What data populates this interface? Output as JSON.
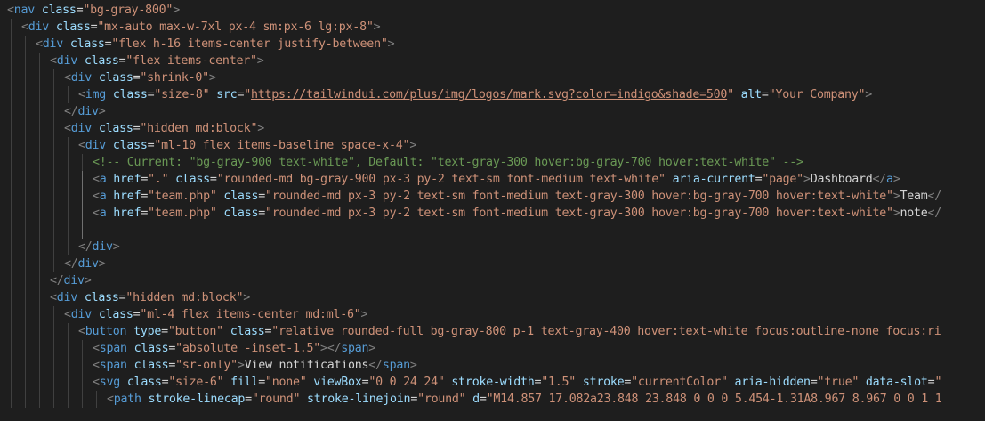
{
  "editor": {
    "colors": {
      "background": "#1e1e1e",
      "tag": "#569cd6",
      "bracket": "#808080",
      "attribute": "#9cdcfe",
      "string": "#ce9178",
      "comment": "#6a9955",
      "text": "#d4d4d4"
    },
    "lines": [
      {
        "indent": 0,
        "tokens": [
          [
            "p",
            "<"
          ],
          [
            "tag",
            "nav"
          ],
          [
            "text",
            " "
          ],
          [
            "attr",
            "class"
          ],
          [
            "eq",
            "="
          ],
          [
            "str",
            "\"bg-gray-800\""
          ],
          [
            "p",
            ">"
          ]
        ]
      },
      {
        "indent": 1,
        "tokens": [
          [
            "p",
            "<"
          ],
          [
            "tag",
            "div"
          ],
          [
            "text",
            " "
          ],
          [
            "attr",
            "class"
          ],
          [
            "eq",
            "="
          ],
          [
            "str",
            "\"mx-auto max-w-7xl px-4 sm:px-6 lg:px-8\""
          ],
          [
            "p",
            ">"
          ]
        ]
      },
      {
        "indent": 2,
        "tokens": [
          [
            "p",
            "<"
          ],
          [
            "tag",
            "div"
          ],
          [
            "text",
            " "
          ],
          [
            "attr",
            "class"
          ],
          [
            "eq",
            "="
          ],
          [
            "str",
            "\"flex h-16 items-center justify-between\""
          ],
          [
            "p",
            ">"
          ]
        ]
      },
      {
        "indent": 3,
        "tokens": [
          [
            "p",
            "<"
          ],
          [
            "tag",
            "div"
          ],
          [
            "text",
            " "
          ],
          [
            "attr",
            "class"
          ],
          [
            "eq",
            "="
          ],
          [
            "str",
            "\"flex items-center\""
          ],
          [
            "p",
            ">"
          ]
        ]
      },
      {
        "indent": 4,
        "tokens": [
          [
            "p",
            "<"
          ],
          [
            "tag",
            "div"
          ],
          [
            "text",
            " "
          ],
          [
            "attr",
            "class"
          ],
          [
            "eq",
            "="
          ],
          [
            "str",
            "\"shrink-0\""
          ],
          [
            "p",
            ">"
          ]
        ]
      },
      {
        "indent": 5,
        "tokens": [
          [
            "p",
            "<"
          ],
          [
            "tag",
            "img"
          ],
          [
            "text",
            " "
          ],
          [
            "attr",
            "class"
          ],
          [
            "eq",
            "="
          ],
          [
            "str",
            "\"size-8\""
          ],
          [
            "text",
            " "
          ],
          [
            "attr",
            "src"
          ],
          [
            "eq",
            "="
          ],
          [
            "str",
            "\""
          ],
          [
            "link",
            "https://tailwindui.com/plus/img/logos/mark.svg?color=indigo&shade=500"
          ],
          [
            "str",
            "\""
          ],
          [
            "text",
            " "
          ],
          [
            "attr",
            "alt"
          ],
          [
            "eq",
            "="
          ],
          [
            "str",
            "\"Your Company\""
          ],
          [
            "p",
            ">"
          ]
        ]
      },
      {
        "indent": 4,
        "tokens": [
          [
            "p",
            "</"
          ],
          [
            "tag",
            "div"
          ],
          [
            "p",
            ">"
          ]
        ]
      },
      {
        "indent": 4,
        "tokens": [
          [
            "p",
            "<"
          ],
          [
            "tag",
            "div"
          ],
          [
            "text",
            " "
          ],
          [
            "attr",
            "class"
          ],
          [
            "eq",
            "="
          ],
          [
            "str",
            "\"hidden md:block\""
          ],
          [
            "p",
            ">"
          ]
        ]
      },
      {
        "indent": 5,
        "tokens": [
          [
            "p",
            "<"
          ],
          [
            "tag",
            "div"
          ],
          [
            "text",
            " "
          ],
          [
            "attr",
            "class"
          ],
          [
            "eq",
            "="
          ],
          [
            "str",
            "\"ml-10 flex items-baseline space-x-4\""
          ],
          [
            "p",
            ">"
          ]
        ]
      },
      {
        "indent": 6,
        "tokens": [
          [
            "comment",
            "<!-- Current: \"bg-gray-900 text-white\", Default: \"text-gray-300 hover:bg-gray-700 hover:text-white\" -->"
          ]
        ]
      },
      {
        "indent": 6,
        "tokens": [
          [
            "p",
            "<"
          ],
          [
            "tag",
            "a"
          ],
          [
            "text",
            " "
          ],
          [
            "attr",
            "href"
          ],
          [
            "eq",
            "="
          ],
          [
            "str",
            "\".\""
          ],
          [
            "text",
            " "
          ],
          [
            "attr",
            "class"
          ],
          [
            "eq",
            "="
          ],
          [
            "str",
            "\"rounded-md bg-gray-900 px-3 py-2 text-sm font-medium text-white\""
          ],
          [
            "text",
            " "
          ],
          [
            "attr",
            "aria-current"
          ],
          [
            "eq",
            "="
          ],
          [
            "str",
            "\"page\""
          ],
          [
            "p",
            ">"
          ],
          [
            "text",
            "Dashboard"
          ],
          [
            "p",
            "</"
          ],
          [
            "tag",
            "a"
          ],
          [
            "p",
            ">"
          ]
        ]
      },
      {
        "indent": 6,
        "tokens": [
          [
            "p",
            "<"
          ],
          [
            "tag",
            "a"
          ],
          [
            "text",
            " "
          ],
          [
            "attr",
            "href"
          ],
          [
            "eq",
            "="
          ],
          [
            "str",
            "\"team.php\""
          ],
          [
            "text",
            " "
          ],
          [
            "attr",
            "class"
          ],
          [
            "eq",
            "="
          ],
          [
            "str",
            "\"rounded-md px-3 py-2 text-sm font-medium text-gray-300 hover:bg-gray-700 hover:text-white\""
          ],
          [
            "p",
            ">"
          ],
          [
            "text",
            "Team"
          ],
          [
            "p",
            "</"
          ]
        ]
      },
      {
        "indent": 6,
        "tokens": [
          [
            "p",
            "<"
          ],
          [
            "tag",
            "a"
          ],
          [
            "text",
            " "
          ],
          [
            "attr",
            "href"
          ],
          [
            "eq",
            "="
          ],
          [
            "str",
            "\"team.php\""
          ],
          [
            "text",
            " "
          ],
          [
            "attr",
            "class"
          ],
          [
            "eq",
            "="
          ],
          [
            "str",
            "\"rounded-md px-3 py-2 text-sm font-medium text-gray-300 hover:bg-gray-700 hover:text-white\""
          ],
          [
            "p",
            ">"
          ],
          [
            "text",
            "note"
          ],
          [
            "p",
            "</"
          ]
        ]
      },
      {
        "indent": 6,
        "tokens": []
      },
      {
        "indent": 5,
        "tokens": [
          [
            "p",
            "</"
          ],
          [
            "tag",
            "div"
          ],
          [
            "p",
            ">"
          ]
        ]
      },
      {
        "indent": 4,
        "tokens": [
          [
            "p",
            "</"
          ],
          [
            "tag",
            "div"
          ],
          [
            "p",
            ">"
          ]
        ]
      },
      {
        "indent": 3,
        "tokens": [
          [
            "p",
            "</"
          ],
          [
            "tag",
            "div"
          ],
          [
            "p",
            ">"
          ]
        ]
      },
      {
        "indent": 3,
        "tokens": [
          [
            "p",
            "<"
          ],
          [
            "tag",
            "div"
          ],
          [
            "text",
            " "
          ],
          [
            "attr",
            "class"
          ],
          [
            "eq",
            "="
          ],
          [
            "str",
            "\"hidden md:block\""
          ],
          [
            "p",
            ">"
          ]
        ]
      },
      {
        "indent": 4,
        "tokens": [
          [
            "p",
            "<"
          ],
          [
            "tag",
            "div"
          ],
          [
            "text",
            " "
          ],
          [
            "attr",
            "class"
          ],
          [
            "eq",
            "="
          ],
          [
            "str",
            "\"ml-4 flex items-center md:ml-6\""
          ],
          [
            "p",
            ">"
          ]
        ]
      },
      {
        "indent": 5,
        "tokens": [
          [
            "p",
            "<"
          ],
          [
            "tag",
            "button"
          ],
          [
            "text",
            " "
          ],
          [
            "attr",
            "type"
          ],
          [
            "eq",
            "="
          ],
          [
            "str",
            "\"button\""
          ],
          [
            "text",
            " "
          ],
          [
            "attr",
            "class"
          ],
          [
            "eq",
            "="
          ],
          [
            "str",
            "\"relative rounded-full bg-gray-800 p-1 text-gray-400 hover:text-white focus:outline-none focus:ri"
          ]
        ]
      },
      {
        "indent": 6,
        "tokens": [
          [
            "p",
            "<"
          ],
          [
            "tag",
            "span"
          ],
          [
            "text",
            " "
          ],
          [
            "attr",
            "class"
          ],
          [
            "eq",
            "="
          ],
          [
            "str",
            "\"absolute -inset-1.5\""
          ],
          [
            "p",
            ">"
          ],
          [
            "p",
            "</"
          ],
          [
            "tag",
            "span"
          ],
          [
            "p",
            ">"
          ]
        ]
      },
      {
        "indent": 6,
        "tokens": [
          [
            "p",
            "<"
          ],
          [
            "tag",
            "span"
          ],
          [
            "text",
            " "
          ],
          [
            "attr",
            "class"
          ],
          [
            "eq",
            "="
          ],
          [
            "str",
            "\"sr-only\""
          ],
          [
            "p",
            ">"
          ],
          [
            "text",
            "View notifications"
          ],
          [
            "p",
            "</"
          ],
          [
            "tag",
            "span"
          ],
          [
            "p",
            ">"
          ]
        ]
      },
      {
        "indent": 6,
        "tokens": [
          [
            "p",
            "<"
          ],
          [
            "tag",
            "svg"
          ],
          [
            "text",
            " "
          ],
          [
            "attr",
            "class"
          ],
          [
            "eq",
            "="
          ],
          [
            "str",
            "\"size-6\""
          ],
          [
            "text",
            " "
          ],
          [
            "attr",
            "fill"
          ],
          [
            "eq",
            "="
          ],
          [
            "str",
            "\"none\""
          ],
          [
            "text",
            " "
          ],
          [
            "attr",
            "viewBox"
          ],
          [
            "eq",
            "="
          ],
          [
            "str",
            "\"0 0 24 24\""
          ],
          [
            "text",
            " "
          ],
          [
            "attr",
            "stroke-width"
          ],
          [
            "eq",
            "="
          ],
          [
            "str",
            "\"1.5\""
          ],
          [
            "text",
            " "
          ],
          [
            "attr",
            "stroke"
          ],
          [
            "eq",
            "="
          ],
          [
            "str",
            "\"currentColor\""
          ],
          [
            "text",
            " "
          ],
          [
            "attr",
            "aria-hidden"
          ],
          [
            "eq",
            "="
          ],
          [
            "str",
            "\"true\""
          ],
          [
            "text",
            " "
          ],
          [
            "attr",
            "data-slot"
          ],
          [
            "eq",
            "="
          ],
          [
            "str",
            "\""
          ]
        ]
      },
      {
        "indent": 7,
        "tokens": [
          [
            "p",
            "<"
          ],
          [
            "tag",
            "path"
          ],
          [
            "text",
            " "
          ],
          [
            "attr",
            "stroke-linecap"
          ],
          [
            "eq",
            "="
          ],
          [
            "str",
            "\"round\""
          ],
          [
            "text",
            " "
          ],
          [
            "attr",
            "stroke-linejoin"
          ],
          [
            "eq",
            "="
          ],
          [
            "str",
            "\"round\""
          ],
          [
            "text",
            " "
          ],
          [
            "attr",
            "d"
          ],
          [
            "eq",
            "="
          ],
          [
            "str",
            "\"M14.857 17.082a23.848 23.848 0 0 0 5.454-1.31A8.967 8.967 0 0 1 1"
          ]
        ]
      }
    ]
  }
}
